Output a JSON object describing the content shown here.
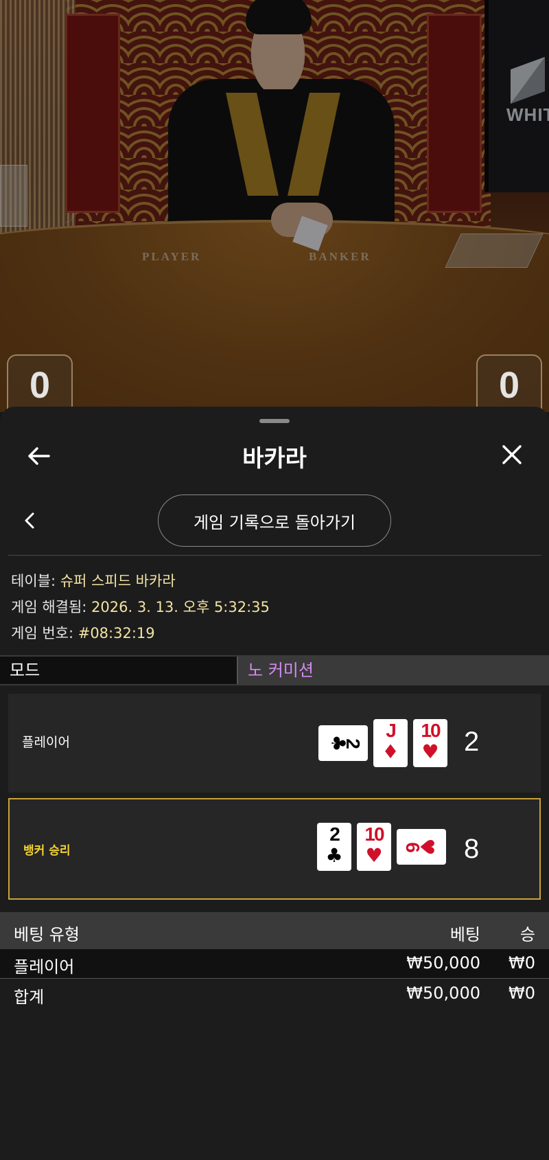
{
  "video": {
    "table_labels": [
      "PLAYER",
      "BANKER"
    ],
    "monitor_text": "WHIT",
    "player_score": "0",
    "banker_score": "0"
  },
  "sheet": {
    "title": "바카라",
    "back_button": "back-arrow-icon",
    "close_button": "close-x-icon",
    "prev_button": "chevron-left-icon",
    "return_button_label": "게임 기록으로 돌아가기",
    "info": {
      "table_label": "테이블:",
      "table_value": "슈퍼 스피드 바카라",
      "resolved_label": "게임 해결됨:",
      "resolved_value": "2026. 3. 13. 오후 5:32:35",
      "game_number_label": "게임 번호:",
      "game_number_value": "#08:32:19"
    },
    "mode": {
      "label": "모드",
      "value": "노 커미션"
    },
    "hands": [
      {
        "label": "플레이어",
        "winner": false,
        "score": "2",
        "cards": [
          {
            "rank": "2",
            "suit": "♣",
            "color": "black",
            "orientation": "sideways"
          },
          {
            "rank": "J",
            "suit": "♦",
            "color": "red",
            "orientation": "upright"
          },
          {
            "rank": "10",
            "suit": "♥",
            "color": "red",
            "orientation": "upright"
          }
        ]
      },
      {
        "label": "뱅커 승리",
        "winner": true,
        "score": "8",
        "cards": [
          {
            "rank": "2",
            "suit": "♣",
            "color": "black",
            "orientation": "upright"
          },
          {
            "rank": "10",
            "suit": "♥",
            "color": "red",
            "orientation": "upright"
          },
          {
            "rank": "6",
            "suit": "♥",
            "color": "red",
            "orientation": "sideways"
          }
        ]
      }
    ],
    "bets": {
      "headers": {
        "type": "베팅 유형",
        "bet": "베팅",
        "win": "승"
      },
      "rows": [
        {
          "type": "플레이어",
          "bet": "₩50,000",
          "win": "₩0"
        }
      ],
      "total": {
        "type": "합계",
        "bet": "₩50,000",
        "win": "₩0"
      }
    }
  },
  "colors": {
    "sheet_bg": "#1c1c1c",
    "info_value": "#f3e3a4",
    "mode_value": "#d48cf0",
    "winner_border": "#c8a43a",
    "winner_label": "#f5d430",
    "card_red": "#d0102a"
  }
}
